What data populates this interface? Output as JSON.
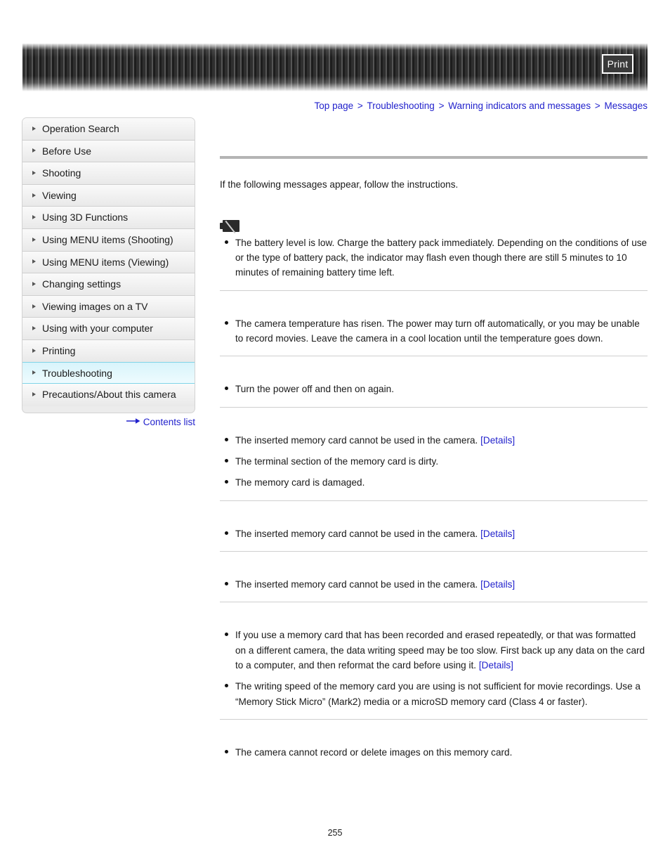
{
  "header": {
    "print_label": "Print"
  },
  "breadcrumb": {
    "separator": ">",
    "items": [
      {
        "label": "Top page"
      },
      {
        "label": "Troubleshooting"
      },
      {
        "label": "Warning indicators and messages"
      },
      {
        "label": "Messages"
      }
    ]
  },
  "sidebar": {
    "items": [
      {
        "label": "Operation Search",
        "active": false
      },
      {
        "label": "Before Use",
        "active": false
      },
      {
        "label": "Shooting",
        "active": false
      },
      {
        "label": "Viewing",
        "active": false
      },
      {
        "label": "Using 3D Functions",
        "active": false
      },
      {
        "label": "Using MENU items (Shooting)",
        "active": false
      },
      {
        "label": "Using MENU items (Viewing)",
        "active": false
      },
      {
        "label": "Changing settings",
        "active": false
      },
      {
        "label": "Viewing images on a TV",
        "active": false
      },
      {
        "label": "Using with your computer",
        "active": false
      },
      {
        "label": "Printing",
        "active": false
      },
      {
        "label": "Troubleshooting",
        "active": true
      },
      {
        "label": "Precautions/About this camera",
        "active": false
      }
    ],
    "contents_list_label": "Contents list"
  },
  "main": {
    "intro": "If the following messages appear, follow the instructions.",
    "details_label": "[Details]",
    "blocks": [
      {
        "icon": "battery-low-icon",
        "bullets": [
          {
            "text": "The battery level is low. Charge the battery pack immediately. Depending on the conditions of use or the type of battery pack, the indicator may flash even though there are still 5 minutes to 10 minutes of remaining battery time left.",
            "details": false
          }
        ]
      },
      {
        "icon": "",
        "bullets": [
          {
            "text": "The camera temperature has risen. The power may turn off automatically, or you may be unable to record movies. Leave the camera in a cool location until the temperature goes down.",
            "details": false
          }
        ]
      },
      {
        "icon": "",
        "bullets": [
          {
            "text": "Turn the power off and then on again.",
            "details": false
          }
        ]
      },
      {
        "icon": "",
        "bullets": [
          {
            "text": "The inserted memory card cannot be used in the camera.",
            "details": true
          },
          {
            "text": "The terminal section of the memory card is dirty.",
            "details": false
          },
          {
            "text": "The memory card is damaged.",
            "details": false
          }
        ]
      },
      {
        "icon": "",
        "bullets": [
          {
            "text": "The inserted memory card cannot be used in the camera.",
            "details": true
          }
        ]
      },
      {
        "icon": "",
        "bullets": [
          {
            "text": "The inserted memory card cannot be used in the camera.",
            "details": true
          }
        ]
      },
      {
        "icon": "",
        "bullets": [
          {
            "text": "If you use a memory card that has been recorded and erased repeatedly, or that was formatted on a different camera, the data writing speed may be too slow. First back up any data on the card to a computer, and then reformat the card before using it.",
            "details": true
          },
          {
            "text": "The writing speed of the memory card you are using is not sufficient for movie recordings. Use a “Memory Stick Micro” (Mark2) media or a microSD memory card (Class 4 or faster).",
            "details": false
          }
        ]
      },
      {
        "icon": "",
        "bullets": [
          {
            "text": "The camera cannot record or delete images on this memory card.",
            "details": false
          }
        ]
      }
    ]
  },
  "footer": {
    "page_number": "255"
  },
  "colors": {
    "link": "#2222cc",
    "active_nav": "#d8f4fb",
    "rule": "#cfcfcf"
  }
}
